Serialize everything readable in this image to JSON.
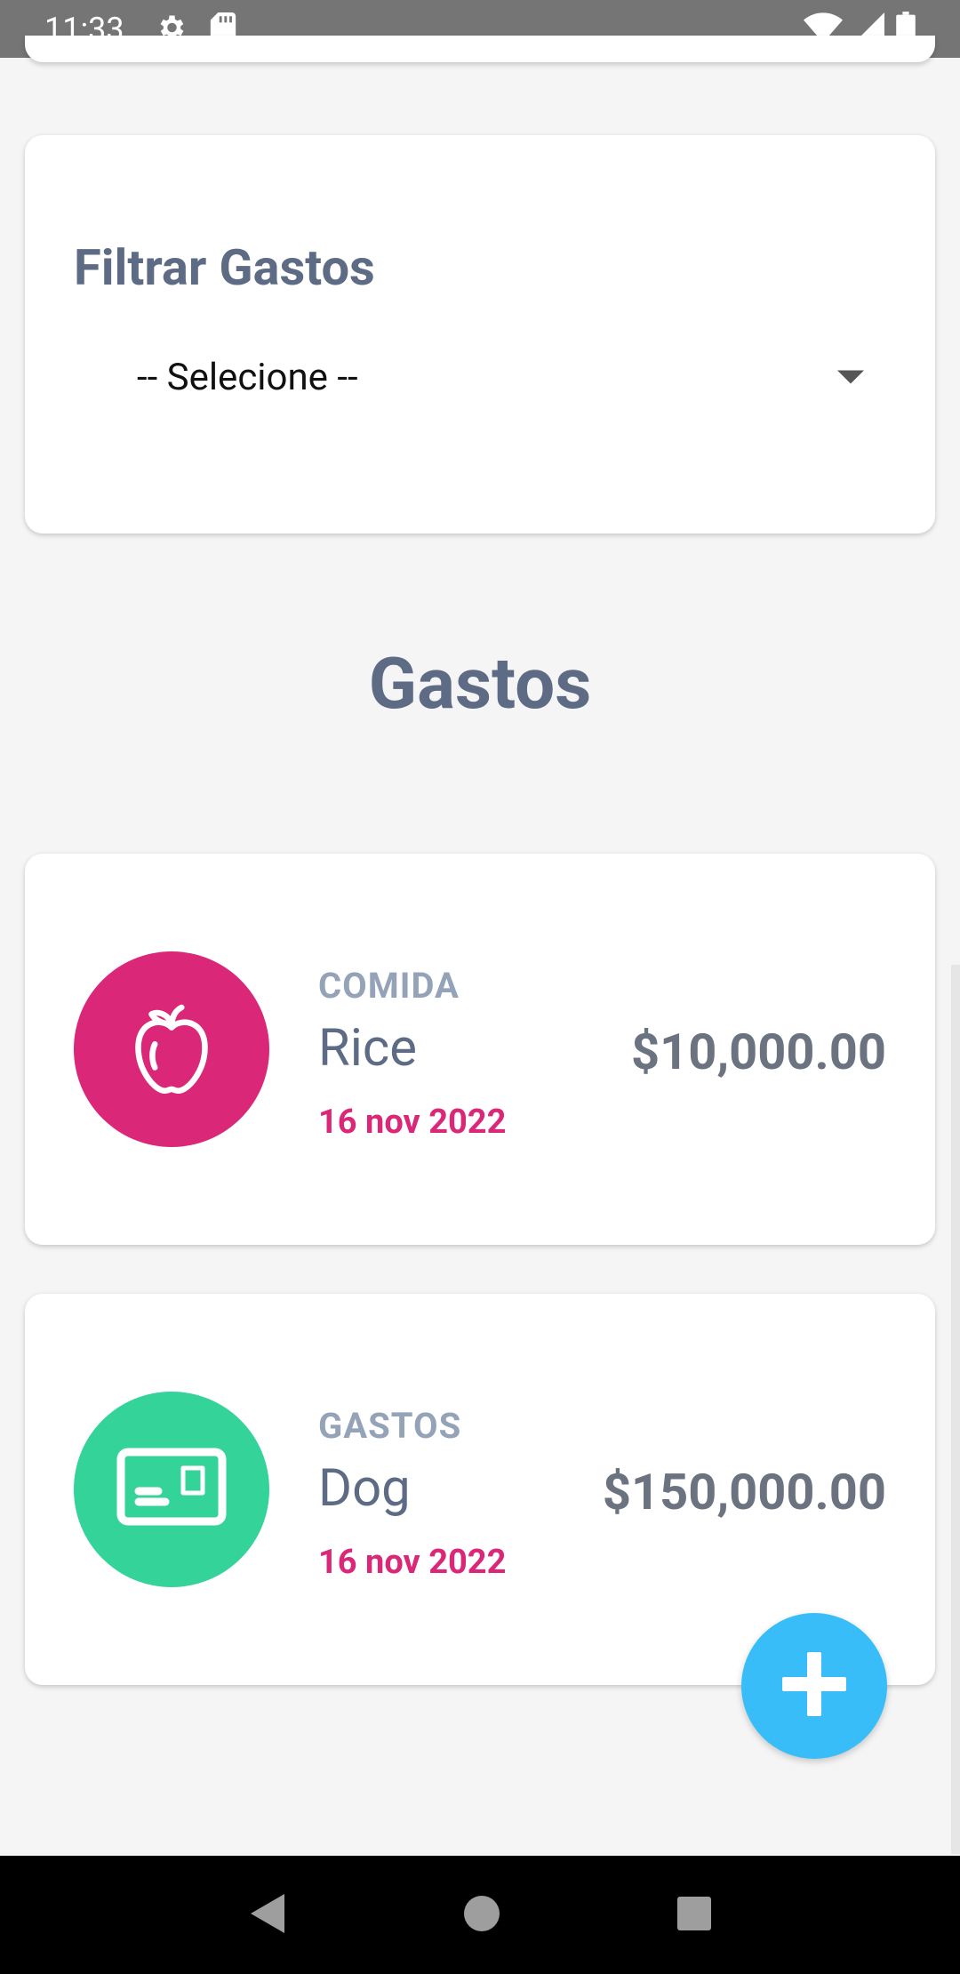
{
  "status_bar": {
    "time": "11:33",
    "icons": [
      "gear-icon",
      "sd-card-icon",
      "wifi-icon",
      "signal-icon",
      "battery-icon"
    ]
  },
  "filter": {
    "title": "Filtrar Gastos",
    "select_value": "-- Selecione --"
  },
  "section": {
    "title": "Gastos"
  },
  "expenses": [
    {
      "category": "COMIDA",
      "name": "Rice",
      "date": "16 nov 2022",
      "amount": "$10,000.00",
      "icon": "apple-icon",
      "icon_color": "#db2777"
    },
    {
      "category": "GASTOS",
      "name": "Dog",
      "date": "16 nov 2022",
      "amount": "$150,000.00",
      "icon": "card-icon",
      "icon_color": "#34d399"
    }
  ],
  "fab": {
    "icon": "plus-icon",
    "color": "#38bdf8"
  },
  "nav_bar": {
    "icons": [
      "back-icon",
      "home-icon",
      "recents-icon"
    ]
  }
}
